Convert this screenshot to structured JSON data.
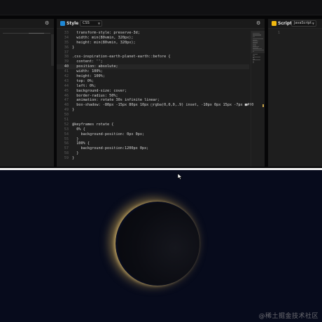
{
  "colors": {
    "accent_css": "#1e88d6",
    "accent_js": "#f2b90f",
    "preview_bg": "#070b1c",
    "planet": "#0c0d12",
    "glow": "#d8b25a"
  },
  "style_pane": {
    "title": "Style",
    "language": "CSS",
    "icon": "css-icon",
    "lines": [
      {
        "n": "33",
        "text": "  transform-style: preserve-3d;"
      },
      {
        "n": "34",
        "text": "  width: min(80vmin, 320px);"
      },
      {
        "n": "35",
        "text": "  height: min(80vmin, 320px);"
      },
      {
        "n": "36",
        "text": "}"
      },
      {
        "n": "37",
        "text": ""
      },
      {
        "n": "38",
        "text": ".css-inspiration-earth-planet-earth::before {"
      },
      {
        "n": "39",
        "text": "  content: '';"
      },
      {
        "n": "40",
        "text": "  position: absolute;",
        "active": true
      },
      {
        "n": "41",
        "text": "  width: 100%;"
      },
      {
        "n": "42",
        "text": "  height: 100%;"
      },
      {
        "n": "43",
        "text": "  top: 0%;"
      },
      {
        "n": "44",
        "text": "  left: 0%;"
      },
      {
        "n": "45",
        "text": "  background-size: cover;"
      },
      {
        "n": "46",
        "text": "  border-radius: 50%;"
      },
      {
        "n": "47",
        "text": "  animation: rotate 30s infinite linear;"
      },
      {
        "n": "48",
        "text": "  box-shadow: -80px -15px 80px 10px □rgba(0,0,0,.9) inset, -10px 0px 15px -7px ■#f0"
      },
      {
        "n": "49",
        "text": "}"
      },
      {
        "n": "50",
        "text": ""
      },
      {
        "n": "51",
        "text": ""
      },
      {
        "n": "52",
        "text": "@keyframes rotate {"
      },
      {
        "n": "53",
        "text": "  0% {"
      },
      {
        "n": "54",
        "text": "    background-position: 0px 0px;"
      },
      {
        "n": "55",
        "text": "  }"
      },
      {
        "n": "56",
        "text": "  100% {"
      },
      {
        "n": "57",
        "text": "    background-position:1200px 0px;"
      },
      {
        "n": "58",
        "text": "  }"
      },
      {
        "n": "59",
        "text": "}"
      }
    ]
  },
  "script_pane": {
    "title": "Script",
    "language": "JavaScript",
    "icon": "js-icon",
    "lines": [
      {
        "n": "1",
        "text": ""
      }
    ]
  },
  "watermark": "@稀土掘金技术社区"
}
